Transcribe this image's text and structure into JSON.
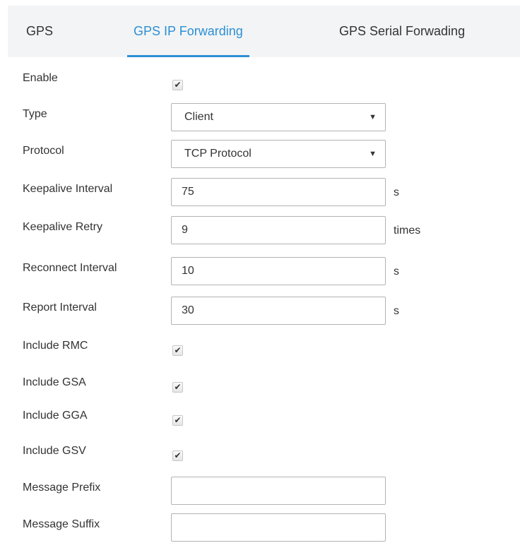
{
  "tabs": [
    {
      "label": "GPS",
      "active": false
    },
    {
      "label": "GPS IP Forwarding",
      "active": true
    },
    {
      "label": "GPS Serial Forwading",
      "active": false
    }
  ],
  "colors": {
    "accent": "#2d8fd5",
    "tab_background": "#f2f4f5",
    "border": "#b3b3b3"
  },
  "form": {
    "enable": {
      "label": "Enable",
      "checked": true,
      "mark": "✔"
    },
    "type": {
      "label": "Type",
      "value": "Client",
      "caret": "▼"
    },
    "protocol": {
      "label": "Protocol",
      "value": "TCP Protocol",
      "caret": "▼"
    },
    "keepalive_interval": {
      "label": "Keepalive Interval",
      "value": "75",
      "unit": "s"
    },
    "keepalive_retry": {
      "label": "Keepalive Retry",
      "value": "9",
      "unit": "times"
    },
    "reconnect_interval": {
      "label": "Reconnect Interval",
      "value": "10",
      "unit": "s"
    },
    "report_interval": {
      "label": "Report Interval",
      "value": "30",
      "unit": "s"
    },
    "include_rmc": {
      "label": "Include RMC",
      "checked": true,
      "mark": "✔"
    },
    "include_gsa": {
      "label": "Include GSA",
      "checked": true,
      "mark": "✔"
    },
    "include_gga": {
      "label": "Include GGA",
      "checked": true,
      "mark": "✔"
    },
    "include_gsv": {
      "label": "Include GSV",
      "checked": true,
      "mark": "✔"
    },
    "message_prefix": {
      "label": "Message Prefix",
      "value": ""
    },
    "message_suffix": {
      "label": "Message Suffix",
      "value": ""
    }
  }
}
